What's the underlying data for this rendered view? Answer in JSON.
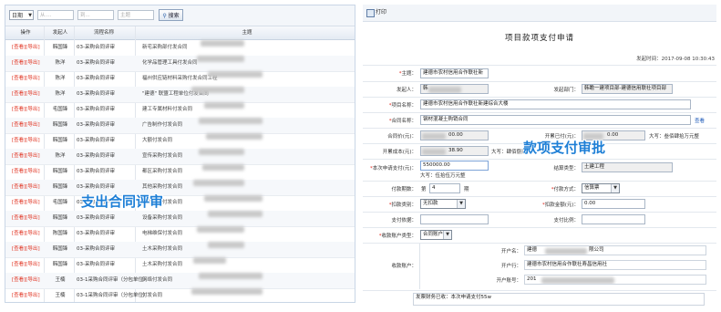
{
  "left": {
    "toolbar": {
      "filter_select": "日期",
      "input_1_placeholder": "从....",
      "input_2_placeholder": "到...",
      "input_3_placeholder": "主题",
      "search_label": "搜索"
    },
    "columns": [
      "操作",
      "发起人",
      "流程名称",
      "主题"
    ],
    "rows": [
      {
        "op": "[查看][导出]",
        "initiator": "韩国锋",
        "flow": "03-采购合同评审",
        "subject": "新宅采购部付发合同"
      },
      {
        "op": "[查看][导出]",
        "initiator": "陈洋",
        "flow": "03-采购合同评审",
        "subject": "化学品管理工具付发合同"
      },
      {
        "op": "[查看][导出]",
        "initiator": "陈洋",
        "flow": "03-采购合同评审",
        "subject": "福州供应链材料采购付发合同工程"
      },
      {
        "op": "[查看][导出]",
        "initiator": "陈洋",
        "flow": "03-采购合同评审",
        "subject": "\"建德\" 联盟工程单位付发合同"
      },
      {
        "op": "[查看][导出]",
        "initiator": "毛国锋",
        "flow": "03-采购合同评审",
        "subject": "建工专属材料付发合同"
      },
      {
        "op": "[查看][导出]",
        "initiator": "韩国锋",
        "flow": "03-采购合同评审",
        "subject": "广告制作付发合同"
      },
      {
        "op": "[查看][导出]",
        "initiator": "韩国锋",
        "flow": "03-采购合同评审",
        "subject": "大额付发合同"
      },
      {
        "op": "[查看][导出]",
        "initiator": "陈洋",
        "flow": "03-采购合同评审",
        "subject": "宣传采购付发合同"
      },
      {
        "op": "[查看][导出]",
        "initiator": "韩国锋",
        "flow": "03-采购合同评审",
        "subject": "都区采购付发合同"
      },
      {
        "op": "[查看][导出]",
        "initiator": "韩国锋",
        "flow": "03-采购合同评审",
        "subject": "其他采购付发合同"
      },
      {
        "op": "[查看][导出]",
        "initiator": "毛国锋",
        "flow": "03-采购合同评审",
        "subject": "交通采购付发合同"
      },
      {
        "op": "[查看][导出]",
        "initiator": "韩国锋",
        "flow": "03-采购合同评审",
        "subject": "设备采购付发合同"
      },
      {
        "op": "[查看][导出]",
        "initiator": "陈国锋",
        "flow": "03-采购合同评审",
        "subject": "电梯维保付发合同"
      },
      {
        "op": "[查看][导出]",
        "initiator": "韩国锋",
        "flow": "03-采购合同评审",
        "subject": "土木采购付发合同"
      },
      {
        "op": "[查看][导出]",
        "initiator": "韩国锋",
        "flow": "03-采购合同评审",
        "subject": "土木采购付发合同"
      },
      {
        "op": "[查看][导出]",
        "initiator": "王楠",
        "flow": "03-1采购合同评审（分包单位）",
        "subject": "网络付发合同"
      },
      {
        "op": "[查看][导出]",
        "initiator": "王楠",
        "flow": "03-1采购合同评审（分包单位）",
        "subject": "付发合同"
      }
    ],
    "overlay_label": "支出合同评审"
  },
  "right": {
    "toolbar_print": "打印",
    "form_title": "项目款项支付申请",
    "time": "发起时间：2017-09-08 10:30:43",
    "subject_label": "主题：",
    "subject_value": "建德市农村信用合作联社新",
    "initiator_label": "发起人：",
    "initiator_value": "韩",
    "dept_label": "发起部门：",
    "dept_value": "韩瞻一建项目部-建德信用联社项目部",
    "project_label": "项目名称：",
    "project_value": "建德市农村信用合作联社新建综合大楼",
    "contract_label": "合同名称：",
    "contract_value": "钢材混凝土购销合同",
    "contract_link": "查看",
    "contract_price_label": "合同价(元)：",
    "contract_price_value": "00.00",
    "paid_label": "开累已付(元)：",
    "paid_value": "0.00",
    "paid_caps": "大写：叁佰肆拾万元整",
    "cost_label": "开累成本(元)：",
    "cost_value": "38.90",
    "cost_caps": "大写：肆佰捌拾",
    "apply_label": "本次申请支付(元)：",
    "apply_value": "550000.00",
    "apply_caps": "大写：伍拾伍万元整",
    "settle_label": "结算类型：",
    "settle_value": "土建工程",
    "count_label": "付款期数：",
    "count_prefix": "第",
    "count_value": "4",
    "count_suffix": "期",
    "method_label": "付款方式：",
    "method_value": "信算票",
    "deduct_type_label": "扣款类别：",
    "deduct_type_value": "无扣款",
    "deduct_amt_label": "扣款金额(元)：",
    "deduct_amt_value": "0.00",
    "basis_label": "支付依据：",
    "ratio_label": "支付比例：",
    "account_type_label": "收款账户类型：",
    "account_type_value": "合同账户",
    "payee_section_label": "收款账户：",
    "holder_label": "开户名：",
    "holder_value": "建德",
    "holder_value2": "限公司",
    "bank_label": "开户行：",
    "bank_value": "建德市农村信用合作联社寿昌信用社",
    "acct_label": "开户账号：",
    "acct_value": "201",
    "note_value": "发票财务已收：本次申请支付55w",
    "overlay_label": "款项支付审批"
  }
}
